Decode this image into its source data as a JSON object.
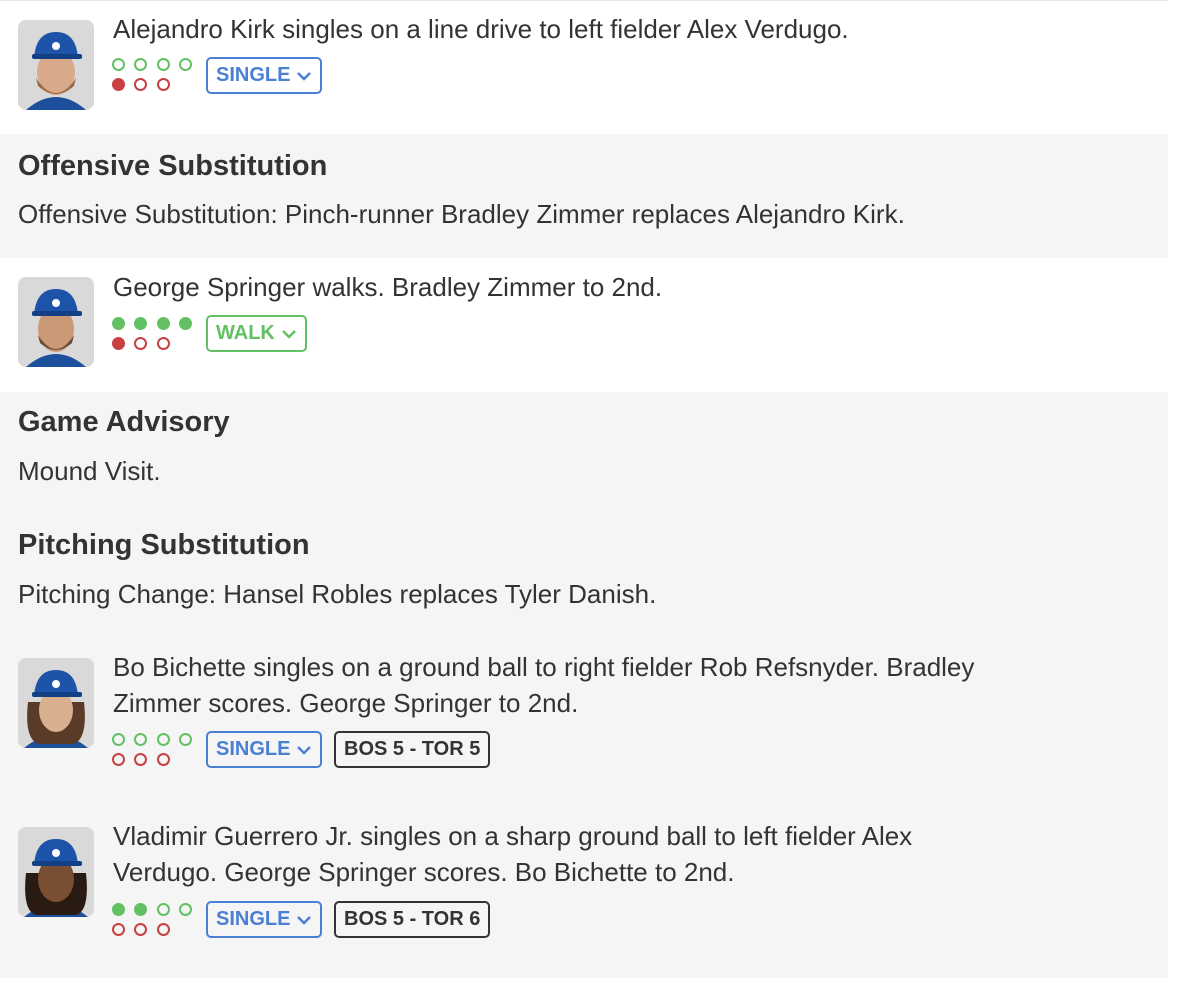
{
  "colors": {
    "ball": "#63c063",
    "strike": "#c94040",
    "tag_blue": "#4a7fd4",
    "tag_green": "#63c063",
    "section_bg": "#f5f5f5"
  },
  "plays": [
    {
      "description": "Alejandro Kirk singles on a line drive to left fielder Alex Verdugo.",
      "result": "SINGLE",
      "balls": 0,
      "strikes": 1,
      "avatar_icon": "player-headshot-icon"
    },
    {
      "description": "George Springer walks. Bradley Zimmer to 2nd.",
      "result": "WALK",
      "balls": 4,
      "strikes": 1,
      "avatar_icon": "player-headshot-icon"
    },
    {
      "description_line1": "Bo Bichette singles on a ground ball to right fielder Rob Refsnyder. Bradley",
      "description_line2": "Zimmer scores. George Springer to 2nd.",
      "result": "SINGLE",
      "score": "BOS 5 - TOR 5",
      "balls": 0,
      "strikes": 0,
      "avatar_icon": "player-headshot-icon"
    },
    {
      "description_line1": "Vladimir Guerrero Jr. singles on a sharp ground ball to left fielder Alex",
      "description_line2": "Verdugo. George Springer scores. Bo Bichette to 2nd.",
      "result": "SINGLE",
      "score": "BOS 5 - TOR 6",
      "balls": 2,
      "strikes": 0,
      "avatar_icon": "player-headshot-icon"
    }
  ],
  "events": [
    {
      "title": "Offensive Substitution",
      "description": "Offensive Substitution: Pinch-runner Bradley Zimmer replaces Alejandro Kirk."
    },
    {
      "title": "Game Advisory",
      "description": "Mound Visit."
    },
    {
      "title": "Pitching Substitution",
      "description": "Pitching Change: Hansel Robles replaces Tyler Danish."
    }
  ]
}
